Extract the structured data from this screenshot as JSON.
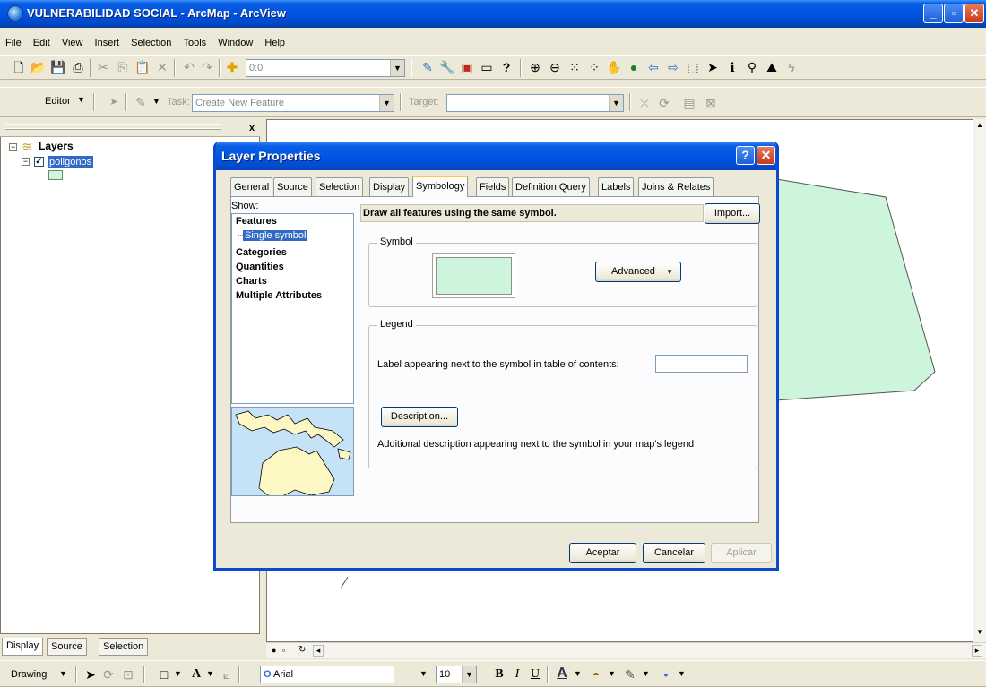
{
  "window": {
    "title": "VULNERABILIDAD SOCIAL - ArcMap - ArcView"
  },
  "menu": [
    "File",
    "Edit",
    "View",
    "Insert",
    "Selection",
    "Tools",
    "Window",
    "Help"
  ],
  "toolbar": {
    "scale_value": "0:0"
  },
  "editor": {
    "editor_label": "Editor",
    "task_label": "Task:",
    "task_value": "Create New Feature",
    "target_label": "Target:"
  },
  "toc": {
    "root_label": "Layers",
    "layer_label": "poligonos",
    "layer_checked": true,
    "symbol_color": "#ccf5db",
    "tabs": [
      "Display",
      "Source",
      "Selection"
    ]
  },
  "dialog": {
    "title": "Layer Properties",
    "tabs": [
      "General",
      "Source",
      "Selection",
      "Display",
      "Symbology",
      "Fields",
      "Definition Query",
      "Labels",
      "Joins & Relates"
    ],
    "active_tab": "Symbology",
    "show_label": "Show:",
    "show_items": [
      "Features",
      "Single symbol",
      "Categories",
      "Quantities",
      "Charts",
      "Multiple Attributes"
    ],
    "selected_show_item": "Single symbol",
    "header": "Draw all features using the same symbol.",
    "import_label": "Import...",
    "symbol_group": "Symbol",
    "advanced_label": "Advanced",
    "legend_group": "Legend",
    "legend_label_text": "Label appearing next to the symbol in table of contents:",
    "legend_label_value": "",
    "description_button": "Description...",
    "description_hint": "Additional description appearing next to the symbol in your map's legend",
    "ok_label": "Aceptar",
    "cancel_label": "Cancelar",
    "apply_label": "Aplicar",
    "symbol_color": "#ccf5db"
  },
  "drawbar": {
    "drawing_label": "Drawing",
    "font_value": "Arial",
    "size_value": "10",
    "bold": "B",
    "italic": "I",
    "underline": "U"
  },
  "map": {
    "polygon_fill": "#ccf5db"
  }
}
